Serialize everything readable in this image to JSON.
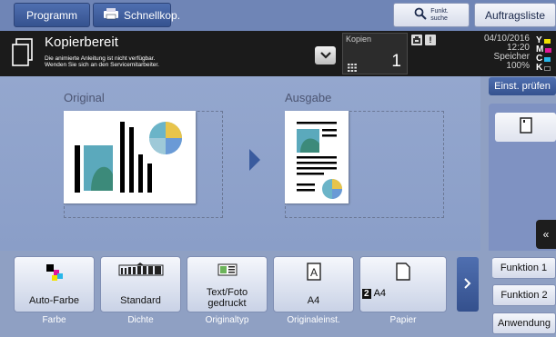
{
  "topbar": {
    "programm": "Programm",
    "schnellkop": "Schnellkop.",
    "funkt_line1": "Funkt.",
    "funkt_line2": "suche",
    "auftragsliste": "Auftragsliste"
  },
  "status": {
    "title": "Kopierbereit",
    "message_line1": "Die animierte Anleitung ist nicht verfügbar.",
    "message_line2": "Wenden Sie sich an den Servicemitarbeiter.",
    "kopien_label": "Kopien",
    "kopien_count": "1",
    "date": "04/10/2016",
    "time": "12:20",
    "memory_label": "Speicher",
    "memory_value": "100%",
    "toner": [
      {
        "letter": "Y",
        "color": "#f2e200"
      },
      {
        "letter": "M",
        "color": "#e0189a"
      },
      {
        "letter": "C",
        "color": "#27b6e9"
      },
      {
        "letter": "K",
        "color": "#111111"
      }
    ]
  },
  "main": {
    "original_label": "Original",
    "ausgabe_label": "Ausgabe"
  },
  "right": {
    "einst_pruefen": "Einst. prüfen",
    "back_icon": "double-chevron-left-icon"
  },
  "tiles": [
    {
      "text": "Auto-Farbe",
      "caption": "Farbe",
      "icon": "color-icon"
    },
    {
      "text": "Standard",
      "caption": "Dichte",
      "icon": "density-icon"
    },
    {
      "text": "Text/Foto gedruckt",
      "caption": "Originaltyp",
      "icon": "original-type-icon"
    },
    {
      "text": "A4",
      "caption": "Originaleinst.",
      "icon": "original-setting-icon"
    },
    {
      "text": "A4",
      "tray": "2",
      "caption": "Papier",
      "icon": "paper-icon"
    }
  ],
  "functions": {
    "f1": "Funktion 1",
    "f2": "Funktion 2",
    "anwendung": "Anwendung"
  },
  "colors": {
    "topbar": "#6f85b6",
    "button_blue": "#3f5ea0",
    "status_bg": "#1b1b1b",
    "main_bg": "#8fa0c3"
  }
}
